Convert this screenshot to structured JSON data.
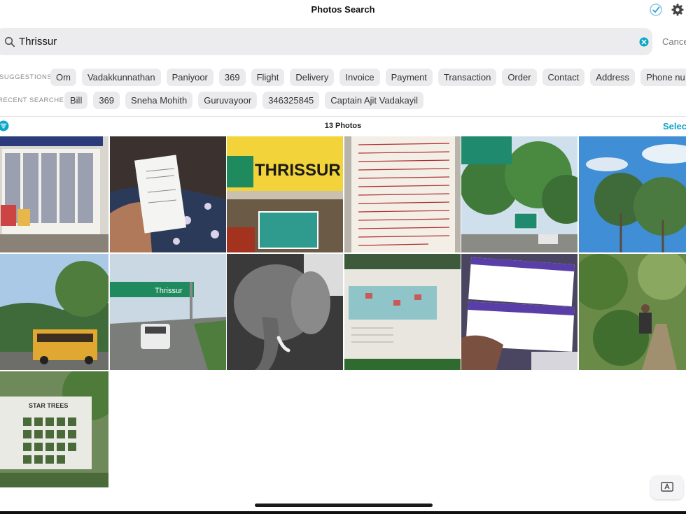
{
  "header": {
    "title": "Photos Search"
  },
  "search": {
    "query": "Thrissur",
    "cancel_label": "Cance"
  },
  "suggestions": {
    "label": "SUGGESTIONS",
    "items": [
      "Om",
      "Vadakkunnathan",
      "Paniyoor",
      "369",
      "Flight",
      "Delivery",
      "Invoice",
      "Payment",
      "Transaction",
      "Order",
      "Contact",
      "Address",
      "Phone nu"
    ]
  },
  "recent": {
    "label": "RECENT SEARCHES",
    "items": [
      "Bill",
      "369",
      "Sneha Mohith",
      "Guruvayoor",
      "346325845",
      "Captain Ajit Vadakayil"
    ]
  },
  "results": {
    "count_label": "13 Photos",
    "select_label": "Selec",
    "photos": [
      {
        "name": "photo-notice-board",
        "sign_text": ""
      },
      {
        "name": "photo-receipt-in-hand",
        "sign_text": ""
      },
      {
        "name": "photo-thrissur-sign",
        "sign_text": "THRISSUR"
      },
      {
        "name": "photo-handwritten-page",
        "sign_text": ""
      },
      {
        "name": "photo-road-sign-trees",
        "sign_text": ""
      },
      {
        "name": "photo-trees-blue-sky",
        "sign_text": ""
      },
      {
        "name": "photo-yellow-bus",
        "sign_text": ""
      },
      {
        "name": "photo-highway-sign",
        "sign_text": "Thrissur"
      },
      {
        "name": "photo-elephant",
        "sign_text": ""
      },
      {
        "name": "photo-map-board",
        "sign_text": ""
      },
      {
        "name": "photo-boarding-passes",
        "sign_text": ""
      },
      {
        "name": "photo-garden-path",
        "sign_text": ""
      },
      {
        "name": "photo-medicinal-plants-board",
        "sign_text": "STAR TREES"
      }
    ]
  },
  "icons": {
    "accent": "#0aa5c9",
    "search": "magnifier-icon",
    "clear": "clear-icon",
    "filter": "filter-icon",
    "settings": "gear-icon",
    "status": "checkmark-icon",
    "keyboard": "keyboard-icon"
  }
}
